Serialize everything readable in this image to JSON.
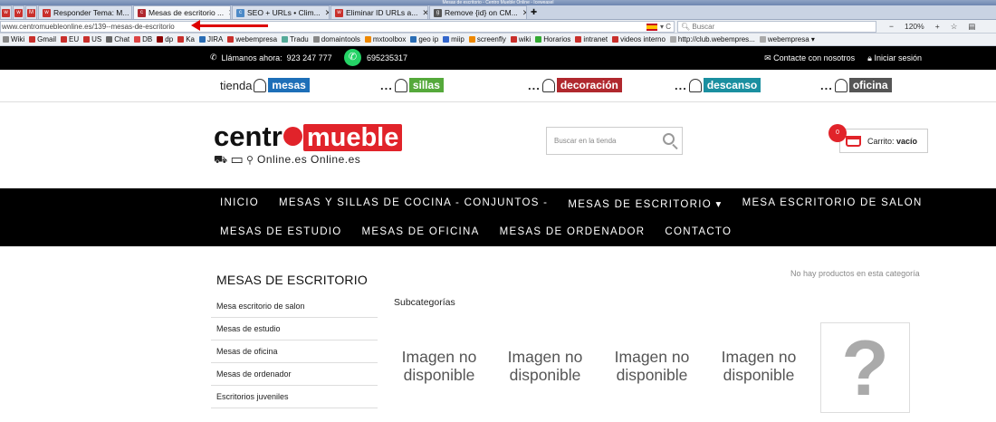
{
  "window": {
    "title": "Mesas de escritorio - Centro Mueble Online - Iceweasel"
  },
  "tabs": [
    {
      "label": "",
      "color": "#c9302c"
    },
    {
      "label": "",
      "color": "#c9302c"
    },
    {
      "label": "",
      "color": "#c9302c"
    },
    {
      "label": "Responder Tema: M...",
      "color": "#c9302c"
    },
    {
      "label": "Mesas de escritorio ...",
      "color": "#b0282e"
    },
    {
      "label": "SEO + URLs • Clim...",
      "color": "#4d8ac7"
    },
    {
      "label": "Eliminar ID URLs a...",
      "color": "#c9302c"
    },
    {
      "label": "Remove {id} on CM...",
      "color": "#555"
    }
  ],
  "urlbar": {
    "url": "www.centromuebleonline.es/139--mesas-de-escritorio",
    "search_placeholder": "Buscar",
    "zoom": "120%"
  },
  "bookmarks": [
    "Wiki",
    "Gmail",
    "EU",
    "US",
    "Chat",
    "DB",
    "dp",
    "Ka",
    "JIRA",
    "webempresa",
    "Tradu",
    "domaintools",
    "mxtoolbox",
    "geo ip",
    "miip",
    "screenfly",
    "wiki",
    "Horarios",
    "intranet",
    "videos interno",
    "http://club.webempres...",
    "webempresa ▾"
  ],
  "topbar": {
    "phone_label": "Llámanos ahora:",
    "phone": "923 247 777",
    "whatsapp": "695235317",
    "contact": "Contacte con nosotros",
    "login": "Iniciar sesión"
  },
  "categories": [
    {
      "prefix": "tienda",
      "label": "mesas",
      "color": "#1d6fb8"
    },
    {
      "prefix": "...",
      "label": "sillas",
      "color": "#55a93b"
    },
    {
      "prefix": "...",
      "label": "decoración",
      "color": "#b0282e"
    },
    {
      "prefix": "...",
      "label": "descanso",
      "color": "#1a8fa0"
    },
    {
      "prefix": "...",
      "label": "oficina",
      "color": "#555555"
    }
  ],
  "logo": {
    "centro": "centr",
    "mueble": "mueble",
    "sub": "Online.es    Online.es"
  },
  "search": {
    "placeholder": "Buscar en la tienda"
  },
  "cart": {
    "count": "0",
    "label": "Carrito:",
    "value": "vacío"
  },
  "nav": {
    "row1": [
      "INICIO",
      "MESAS Y SILLAS DE COCINA - CONJUNTOS -",
      "MESAS DE ESCRITORIO ▾",
      "MESA ESCRITORIO DE SALON"
    ],
    "row2": [
      "MESAS DE ESTUDIO",
      "MESAS DE OFICINA",
      "MESAS DE ORDENADOR",
      "CONTACTO"
    ]
  },
  "page": {
    "title": "MESAS DE ESCRITORIO",
    "no_products": "No hay productos en esta categoría",
    "subcategories": "Subcategorías",
    "image_missing": "Imagen no disponible",
    "question": "?"
  },
  "sidebar": [
    "Mesa escritorio de salon",
    "Mesas de estudio",
    "Mesas de oficina",
    "Mesas de ordenador",
    "Escritorios juveniles"
  ]
}
